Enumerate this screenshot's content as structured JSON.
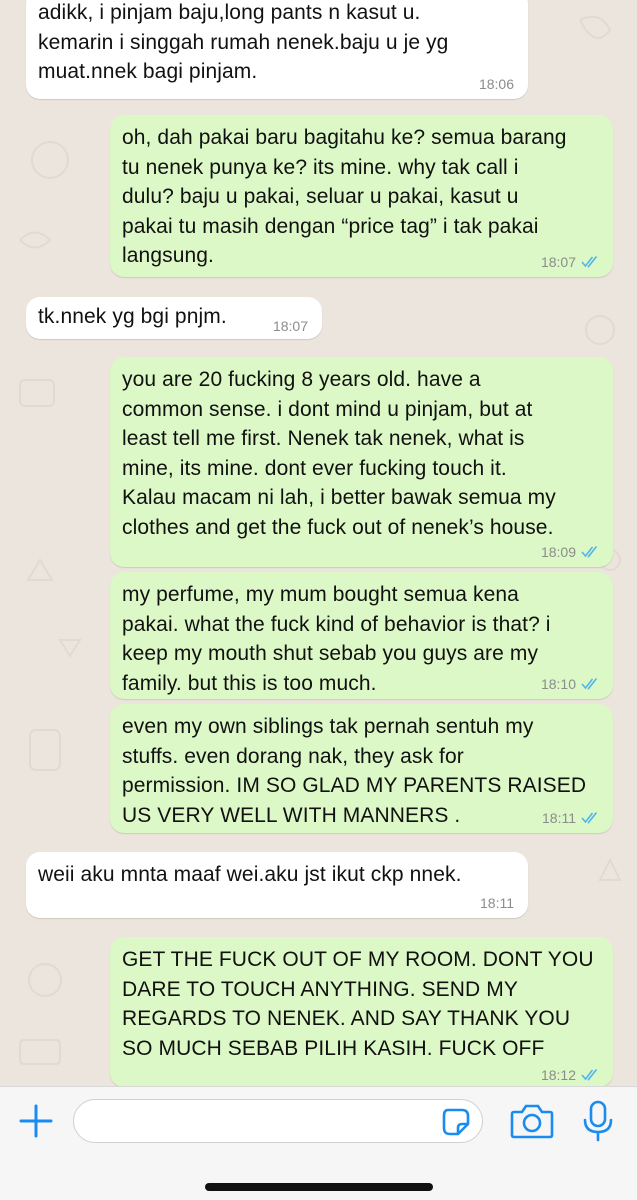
{
  "colors": {
    "background": "#ece5dd",
    "incoming_bubble": "#ffffff",
    "outgoing_bubble": "#dcf8c6",
    "read_ticks": "#4fb6ec",
    "accent": "#1a8cf0"
  },
  "messages": [
    {
      "direction": "incoming",
      "text": "adikk, i pinjam baju,long pants n kasut u.\nkemarin i singgah rumah nenek.baju u je yg\nmuat.nnek bagi pinjam.",
      "time": "18:06",
      "status": ""
    },
    {
      "direction": "outgoing",
      "text": "oh, dah pakai baru bagitahu ke? semua barang\ntu nenek punya ke? its mine. why tak call i\ndulu? baju u pakai, seluar u pakai, kasut u\npakai tu masih dengan “price tag” i tak pakai\nlangsung.",
      "time": "18:07",
      "status": "read"
    },
    {
      "direction": "incoming",
      "text": "tk.nnek yg bgi pnjm.",
      "time": "18:07",
      "status": ""
    },
    {
      "direction": "outgoing",
      "text": "you are 20 fucking 8 years old. have a\ncommon sense. i dont mind u pinjam, but at\nleast tell me first. Nenek tak nenek, what is\nmine, its mine. dont ever fucking touch it.\nKalau macam ni lah, i better bawak semua my\nclothes and get the fuck out of nenek’s house.",
      "time": "18:09",
      "status": "read"
    },
    {
      "direction": "outgoing",
      "text": "my perfume, my mum bought semua kena\npakai. what the fuck kind of behavior is that? i\nkeep my mouth shut sebab you guys are my\nfamily. but this is too much.",
      "time": "18:10",
      "status": "read"
    },
    {
      "direction": "outgoing",
      "text": "even my own siblings tak pernah sentuh my\nstuffs. even dorang nak, they ask for\npermission. IM SO GLAD MY PARENTS RAISED\nUS VERY WELL WITH MANNERS .",
      "time": "18:11",
      "status": "read"
    },
    {
      "direction": "incoming",
      "text": "weii aku mnta maaf wei.aku jst ikut ckp nnek.",
      "time": "18:11",
      "status": ""
    },
    {
      "direction": "outgoing",
      "text": "GET THE FUCK OUT OF MY ROOM. DONT YOU\nDARE TO TOUCH ANYTHING. SEND MY\nREGARDS TO NENEK. AND SAY THANK YOU\nSO MUCH SEBAB PILIH KASIH. FUCK OFF",
      "time": "18:12",
      "status": "read"
    }
  ],
  "composer": {
    "input_value": "",
    "icons": [
      "plus-icon",
      "sticker-icon",
      "camera-icon",
      "microphone-icon"
    ]
  }
}
